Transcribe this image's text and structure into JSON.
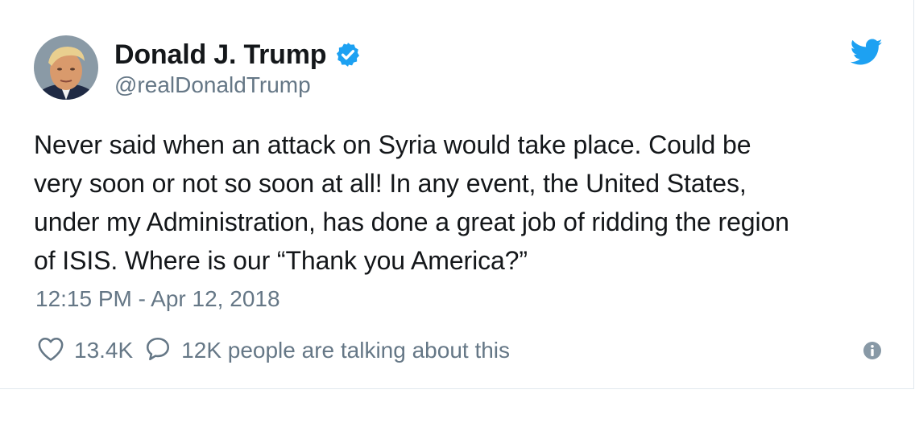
{
  "author": {
    "name": "Donald J. Trump",
    "handle": "@realDonaldTrump",
    "verified_icon": "verified-badge-icon",
    "avatar_icon": "avatar-photo"
  },
  "brand": {
    "logo_icon": "twitter-bird-icon",
    "accent_color": "#1da1f2"
  },
  "tweet": {
    "lines": [
      "Never said when an attack on Syria would take place. Could be",
      "very soon or not so soon at all! In any event, the United States,",
      "under my Administration, has done a great job of ridding the region",
      "of ISIS. Where is our “Thank you America?”"
    ],
    "timestamp": "12:15 PM - Apr 12, 2018"
  },
  "actions": {
    "like_icon": "heart-icon",
    "like_count": "13.4K",
    "reply_icon": "speech-bubble-icon",
    "talking_text": "12K people are talking about this",
    "info_icon": "info-icon"
  },
  "colors": {
    "text": "#14171a",
    "secondary": "#657786",
    "border": "#e1e8ed"
  }
}
